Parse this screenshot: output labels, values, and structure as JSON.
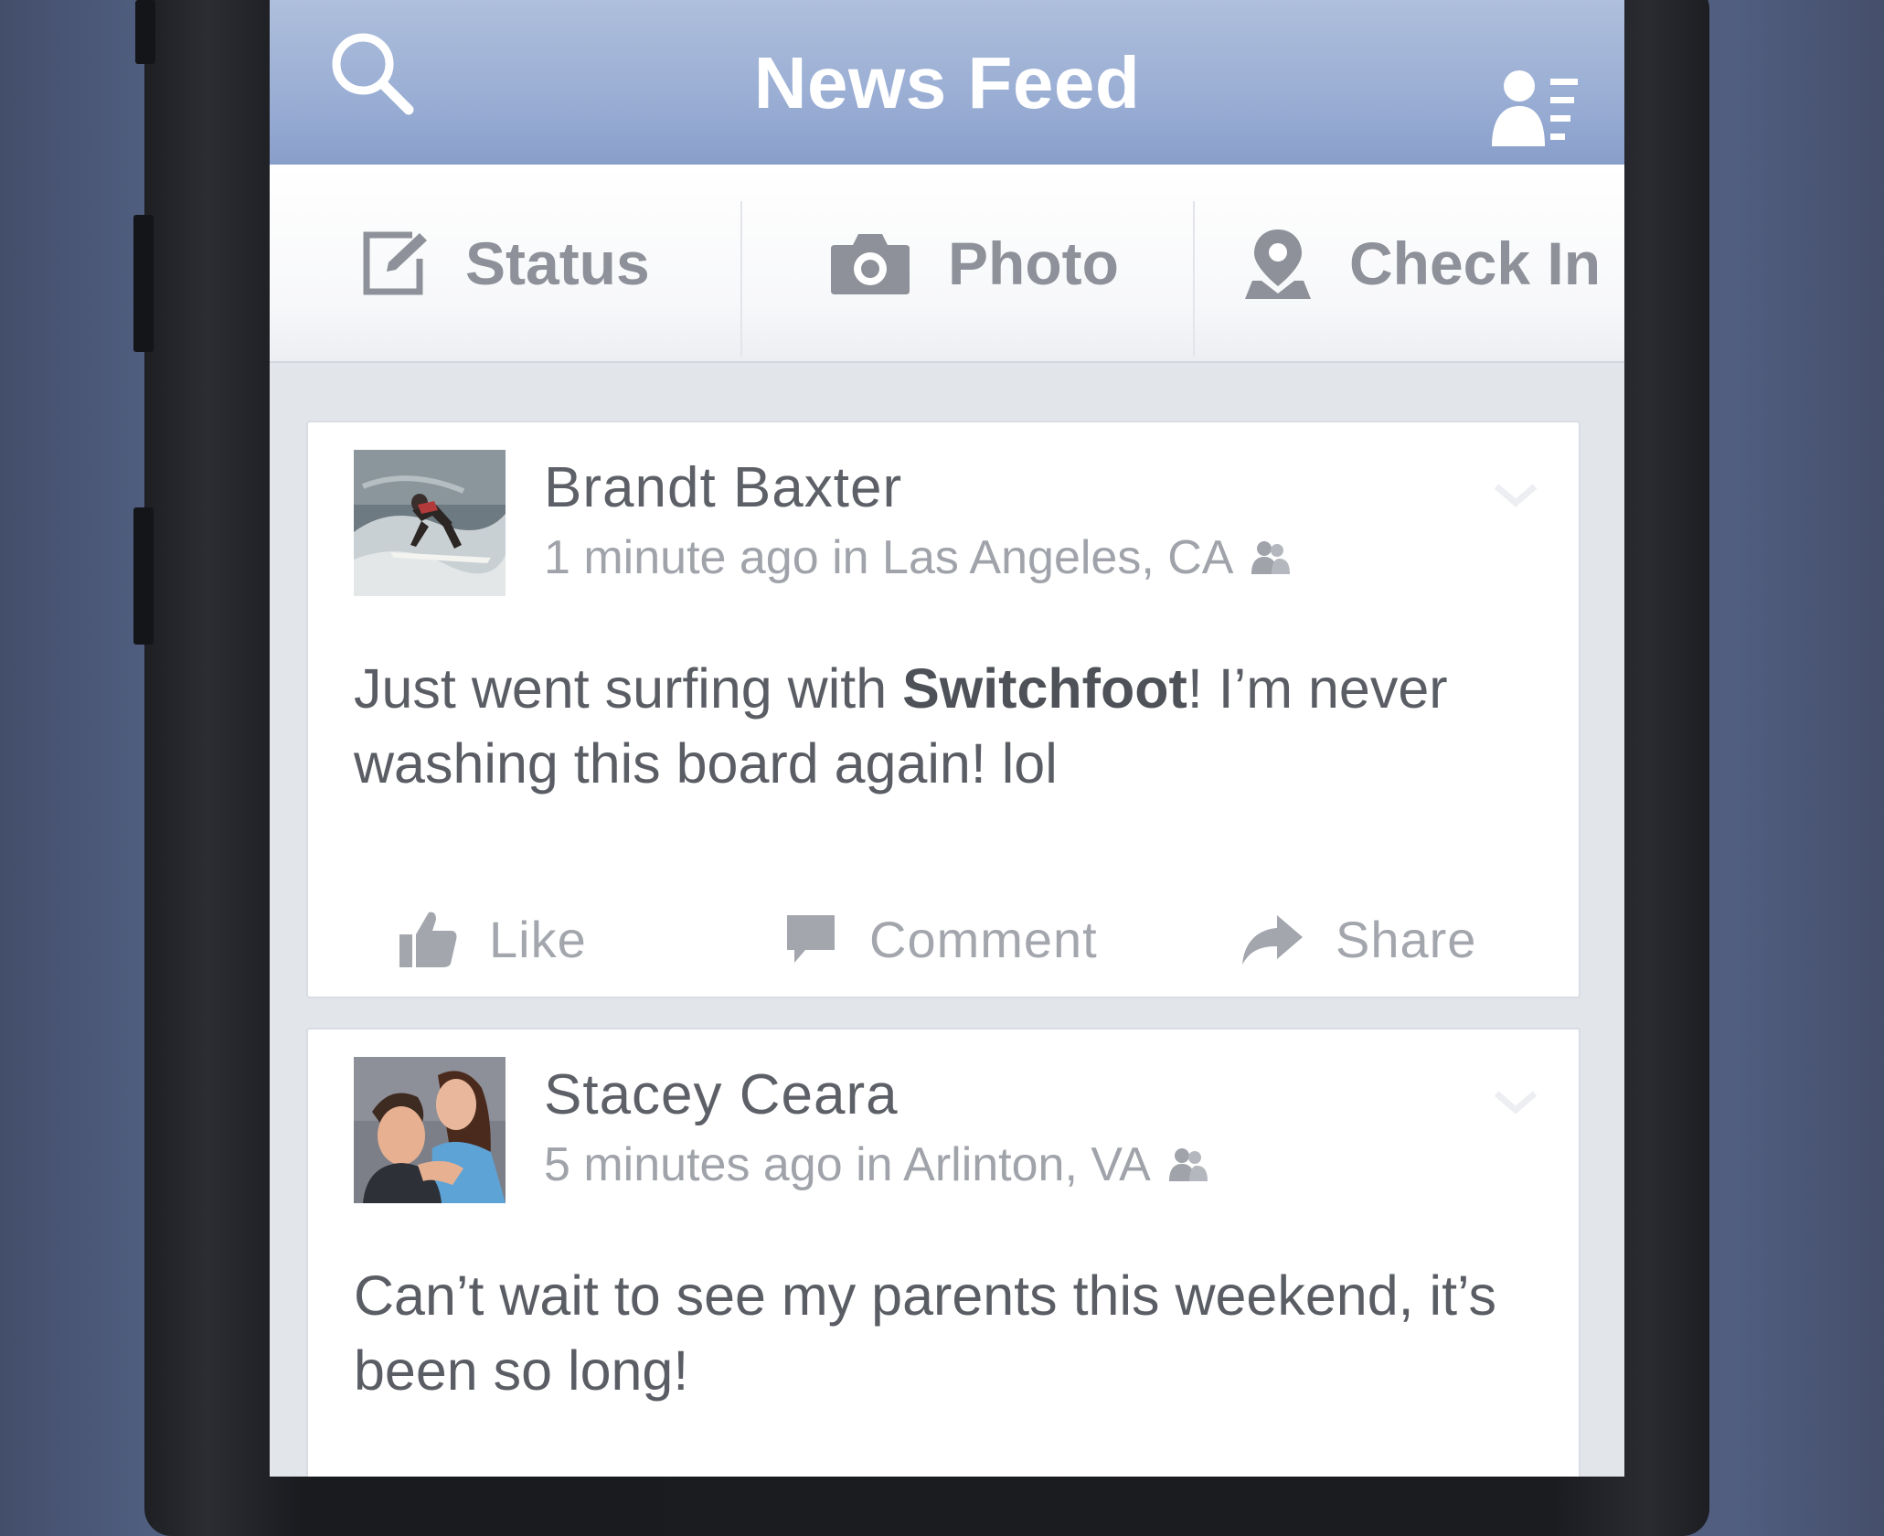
{
  "header": {
    "title": "News Feed",
    "search_icon": "search-icon",
    "friends_icon": "friend-requests-icon"
  },
  "composer": {
    "status_label": "Status",
    "photo_label": "Photo",
    "checkin_label": "Check In"
  },
  "posts": [
    {
      "author": "Brandt Baxter",
      "meta": "1 minute ago in Las Angeles, CA",
      "text_before": "Just went surfing with ",
      "text_bold": "Switchfoot",
      "text_after": "! I’m never washing this board again! lol",
      "like_label": "Like",
      "comment_label": "Comment",
      "share_label": "Share"
    },
    {
      "author": "Stacey Ceara",
      "meta": "5 minutes ago in Arlinton, VA",
      "text": "Can’t wait to see my parents this weekend, it’s been so long!"
    }
  ],
  "colors": {
    "header_blue": "#8fa5d0",
    "background": "#56648a",
    "text_gray": "#5d6067",
    "meta_gray": "#a0a3aa"
  }
}
